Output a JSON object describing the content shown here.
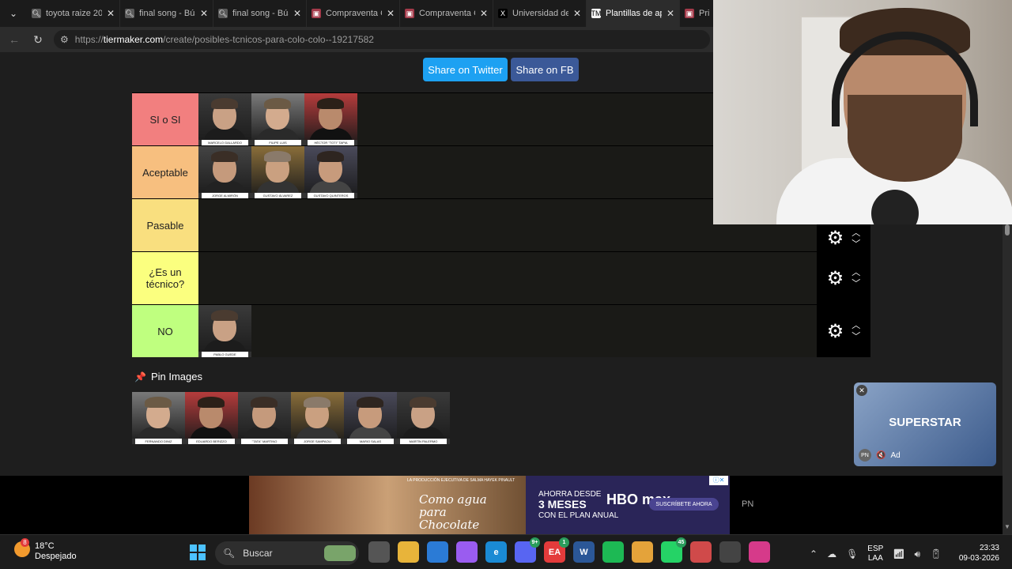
{
  "browser": {
    "tabs": [
      {
        "title": "toyota raize 202",
        "favicon": "search",
        "active": false
      },
      {
        "title": "final song - Bús",
        "favicon": "search",
        "active": false
      },
      {
        "title": "final song - Bús",
        "favicon": "search",
        "active": false
      },
      {
        "title": "Compraventa G",
        "favicon": "site",
        "active": false
      },
      {
        "title": "Compraventa G",
        "favicon": "site",
        "active": false
      },
      {
        "title": "Universidad de",
        "favicon": "x-logo",
        "active": false
      },
      {
        "title": "Plantillas de apl",
        "favicon": "tiermaker",
        "active": true
      },
      {
        "title": "Pri",
        "favicon": "site",
        "active": false
      }
    ],
    "url_prefix": "https://",
    "url_domain": "tiermaker.com",
    "url_path": "/create/posibles-tcnicos-para-colo-colo--19217582"
  },
  "page": {
    "share_twitter": "Share on Twitter",
    "share_fb": "Share on FB",
    "tiers": [
      {
        "label": "SI o SI",
        "color": "#f27f7f",
        "items": [
          {
            "name": "MARCELO GALLARDO"
          },
          {
            "name": "FILIPE LUIS"
          },
          {
            "name": "HÉCTOR \"TOTI\" TAPIA"
          }
        ]
      },
      {
        "label": "Aceptable",
        "color": "#f7bf7f",
        "items": [
          {
            "name": "JORGE ALMIRÓN"
          },
          {
            "name": "GUSTAVO ÁLVAREZ"
          },
          {
            "name": "GUSTAVO QUINTEROS"
          }
        ]
      },
      {
        "label": "Pasable",
        "color": "#f9df7f",
        "items": []
      },
      {
        "label": "¿Es un técnico?",
        "color": "#fbff7f",
        "items": []
      },
      {
        "label": "NO",
        "color": "#bfff7f",
        "items": [
          {
            "name": "PABLO GUEDE"
          }
        ]
      }
    ],
    "pin_title": "Pin Images",
    "pins": [
      {
        "name": "FERNANDO DINIZ"
      },
      {
        "name": "EDUARDO BERIZZO"
      },
      {
        "name": "\"TATA\" MARTINO"
      },
      {
        "name": "JORGE SAMPAOLI"
      },
      {
        "name": "MARIO SALAS"
      },
      {
        "name": "MARTÍN PALERMO"
      }
    ]
  },
  "video_ad": {
    "text": "SUPERSTAR",
    "badge": "PN",
    "label": "Ad"
  },
  "banner_ad": {
    "subtitle": "LA PRODUCCIÓN EJECUTIVA DE SALMA HAYEK PINAULT",
    "title": "Como agua para Chocolate",
    "offer_line1": "AHORRA DESDE",
    "offer_line2": "3 MESES",
    "offer_line3": "CON EL PLAN ANUAL",
    "logo": "HBO max",
    "cta": "SUSCRÍBETE AHORA",
    "side_label": "PN"
  },
  "taskbar": {
    "temp": "18°C",
    "weather": "Despejado",
    "weather_badge": "8",
    "search_placeholder": "Buscar",
    "lang_line1": "ESP",
    "lang_line2": "LAA",
    "time": "23:33",
    "date": "09-03-2026",
    "apps": [
      {
        "icon": "task-view-icon",
        "color": "#555",
        "text": ""
      },
      {
        "icon": "file-explorer-icon",
        "color": "#e8b43a",
        "text": ""
      },
      {
        "icon": "store-icon",
        "color": "#2b7bd6",
        "text": ""
      },
      {
        "icon": "copilot-icon",
        "color": "#9a5cf0",
        "text": ""
      },
      {
        "icon": "edge-icon",
        "color": "#1a8ad4",
        "text": "e"
      },
      {
        "icon": "discord-icon",
        "color": "#5865f2",
        "text": "",
        "badge": "9+"
      },
      {
        "icon": "ea-icon",
        "color": "#e43b3b",
        "text": "EA",
        "badge": "1"
      },
      {
        "icon": "word-icon",
        "color": "#2b5797",
        "text": "W"
      },
      {
        "icon": "spotify-icon",
        "color": "#1db954",
        "text": ""
      },
      {
        "icon": "chrome-icon",
        "color": "#e4a33a",
        "text": ""
      },
      {
        "icon": "whatsapp-icon",
        "color": "#25d366",
        "text": "",
        "badge": "45"
      },
      {
        "icon": "snipping-icon",
        "color": "#d04a4a",
        "text": ""
      },
      {
        "icon": "obs-icon",
        "color": "#444",
        "text": ""
      },
      {
        "icon": "instagram-icon",
        "color": "#d63a8a",
        "text": ""
      }
    ]
  }
}
